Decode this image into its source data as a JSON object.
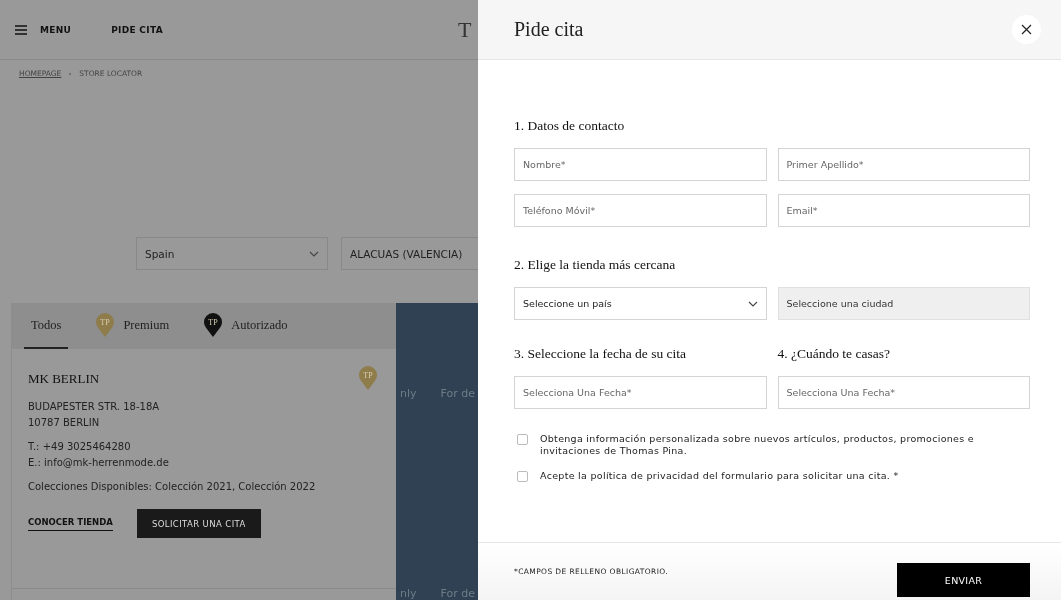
{
  "background_page": {
    "header": {
      "menu_label": "MENU",
      "link": "PIDE CITA",
      "logo": "T"
    },
    "breadcrumb": [
      "HOMEPAGE",
      "STORE LOCATOR"
    ],
    "filters": [
      {
        "value": "Spain",
        "kind": "select"
      },
      {
        "value": "ALACUAS (VALENCIA)",
        "kind": "text"
      }
    ],
    "tabs": [
      {
        "label": "Todos",
        "selected": true
      },
      {
        "label": "Premium",
        "selected": false,
        "pin_label": "TP",
        "color": "#8f7c4b"
      },
      {
        "label": "Autorizado",
        "selected": false,
        "pin_label": "TP",
        "color": "#111111"
      }
    ],
    "store": {
      "name": "MK BERLIN",
      "pin_label": "TP",
      "color": "#8f7c4b",
      "address": [
        "BUDAPESTER STR. 18-18A",
        "10787 BERLIN"
      ],
      "contact": [
        "T.: +49 3025464280",
        "E.: info@mk-herrenmode.de"
      ],
      "collections": "Colecciones Disponibles: Colección 2021, Colección 2022",
      "link": "CONOCER TIENDA",
      "button": "SOLICITAR UNA CITA"
    },
    "map_labels": [
      {
        "a": "nly",
        "b": "For de"
      },
      {
        "a": "nly",
        "b": "For de"
      }
    ]
  },
  "drawer": {
    "title": "Pide cita",
    "sections": [
      {
        "title": "1. Datos de contacto",
        "fields": [
          {
            "placeholder": "Nombre*",
            "kind": "text",
            "disabled": false
          },
          {
            "placeholder": "Primer Apellido*",
            "kind": "text",
            "disabled": false
          },
          {
            "placeholder": "Teléfono Móvil*",
            "kind": "text",
            "disabled": false
          },
          {
            "placeholder": "Email*",
            "kind": "text",
            "disabled": false
          }
        ]
      },
      {
        "title": "2. Elige la tienda más cercana",
        "fields": [
          {
            "placeholder": "Seleccione un país",
            "kind": "select",
            "disabled": false
          },
          {
            "placeholder": "Seleccione una ciudad",
            "kind": "text",
            "disabled": true
          }
        ]
      }
    ],
    "date_sections": [
      {
        "title": "3. Seleccione la fecha de su cita",
        "placeholder": "Selecciona Una Fecha*"
      },
      {
        "title": "4. ¿Cuándo te casas?",
        "placeholder": "Selecciona Una Fecha*"
      }
    ],
    "checkboxes": [
      {
        "label": "Obtenga información personalizada sobre nuevos artículos, productos, promociones e invitaciones de Thomas Pina.",
        "checked": false
      },
      {
        "label": "Acepte la política de privacidad del formulario para solicitar una cita. *",
        "checked": false
      }
    ],
    "footer_note": "*CAMPOS DE RELLENO OBLIGATORIO.",
    "submit": "ENVIAR"
  }
}
